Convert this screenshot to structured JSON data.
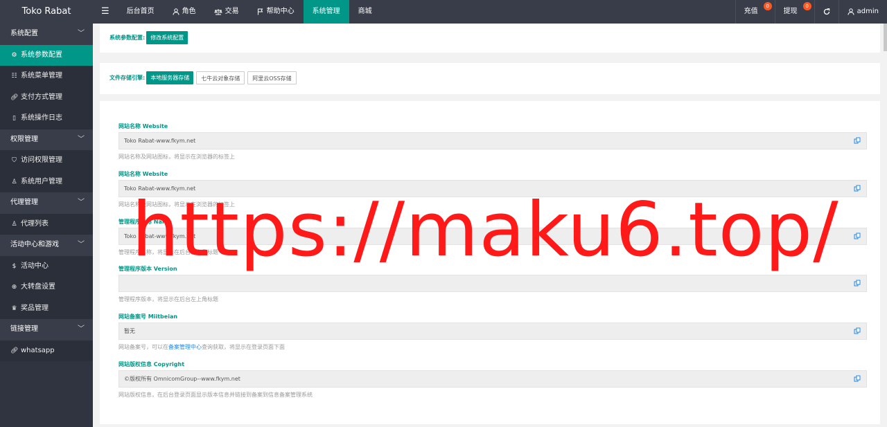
{
  "app": {
    "title": "Toko Rabat"
  },
  "topnav": {
    "menu_toggle": "☰",
    "items": [
      {
        "label": "后台首页",
        "icon": ""
      },
      {
        "label": "角色",
        "icon": "user-icon"
      },
      {
        "label": "交易",
        "icon": "scale-icon"
      },
      {
        "label": "帮助中心",
        "icon": "flag-icon"
      },
      {
        "label": "系统管理",
        "icon": "",
        "active": true
      },
      {
        "label": "商城",
        "icon": ""
      }
    ],
    "recharge": {
      "label": "充值",
      "badge": "0"
    },
    "withdraw": {
      "label": "提现",
      "badge": "0"
    },
    "refresh_icon": "refresh-icon",
    "user": "admin"
  },
  "sidebar": {
    "groups": [
      {
        "label": "系统配置",
        "items": [
          {
            "label": "系统参数配置",
            "icon": "gear-icon",
            "active": true
          },
          {
            "label": "系统菜单管理",
            "icon": "menu-icon"
          },
          {
            "label": "支付方式管理",
            "icon": "link-icon"
          },
          {
            "label": "系统操作日志",
            "icon": "log-icon"
          }
        ]
      },
      {
        "label": "权限管理",
        "items": [
          {
            "label": "访问权限管理",
            "icon": "shield-icon"
          },
          {
            "label": "系统用户管理",
            "icon": "user-icon"
          }
        ]
      },
      {
        "label": "代理管理",
        "items": [
          {
            "label": "代理列表",
            "icon": "user-icon"
          }
        ]
      },
      {
        "label": "活动中心和游戏",
        "items": [
          {
            "label": "活动中心",
            "icon": "dollar-icon"
          },
          {
            "label": "大转盘设置",
            "icon": "globe-icon"
          },
          {
            "label": "奖品管理",
            "icon": "trophy-icon"
          }
        ]
      },
      {
        "label": "链接管理",
        "items": [
          {
            "label": "whatsapp",
            "icon": "link-icon"
          }
        ]
      }
    ]
  },
  "config": {
    "label": "系统参数配置:",
    "button": "修改系统配置"
  },
  "storage": {
    "label": "文件存储引擎:",
    "options": [
      "本地服务器存储",
      "七牛云对象存储",
      "阿里云OSS存储"
    ],
    "selected": "本地服务器存储"
  },
  "fields": [
    {
      "label": "网站名称 Website",
      "value": "Toko Rabat-www.fkym.net",
      "help": "网站名称及网站图标，将显示在浏览器的标签上"
    },
    {
      "label": "网站名称 Website",
      "value": "Toko Rabat-www.fkym.net",
      "help": "网站名称及网站图标，将显示在浏览器的标签上"
    },
    {
      "label": "管理程序名称 Name",
      "value": "Toko Rabat-www.fkym.net",
      "help": "管理程序名称，将显示在后台左上角标题"
    },
    {
      "label": "管理程序版本 Version",
      "value": "",
      "help": "管理程序版本，将显示在后台左上角标题"
    },
    {
      "label": "网站备案号 Miitbeian",
      "value": "暂无",
      "help_pre": "网站备案号，可以在",
      "help_link": "备案管理中心",
      "help_post": "查询获取，将显示在登录页面下面"
    },
    {
      "label": "网站版权信息 Copyright",
      "value": "©版权所有 OmnicomGroup--www.fkym.net",
      "help": "网站版权信息，在后台登录页面显示版本信息并链接到备案到信息备案管理系统"
    }
  ],
  "watermark": "https://maku6.top/",
  "colors": {
    "accent": "#009688",
    "topbar": "#393d49",
    "sidebar": "#2f3440",
    "badge": "#ff5722",
    "watermark": "#ff1a1a"
  }
}
